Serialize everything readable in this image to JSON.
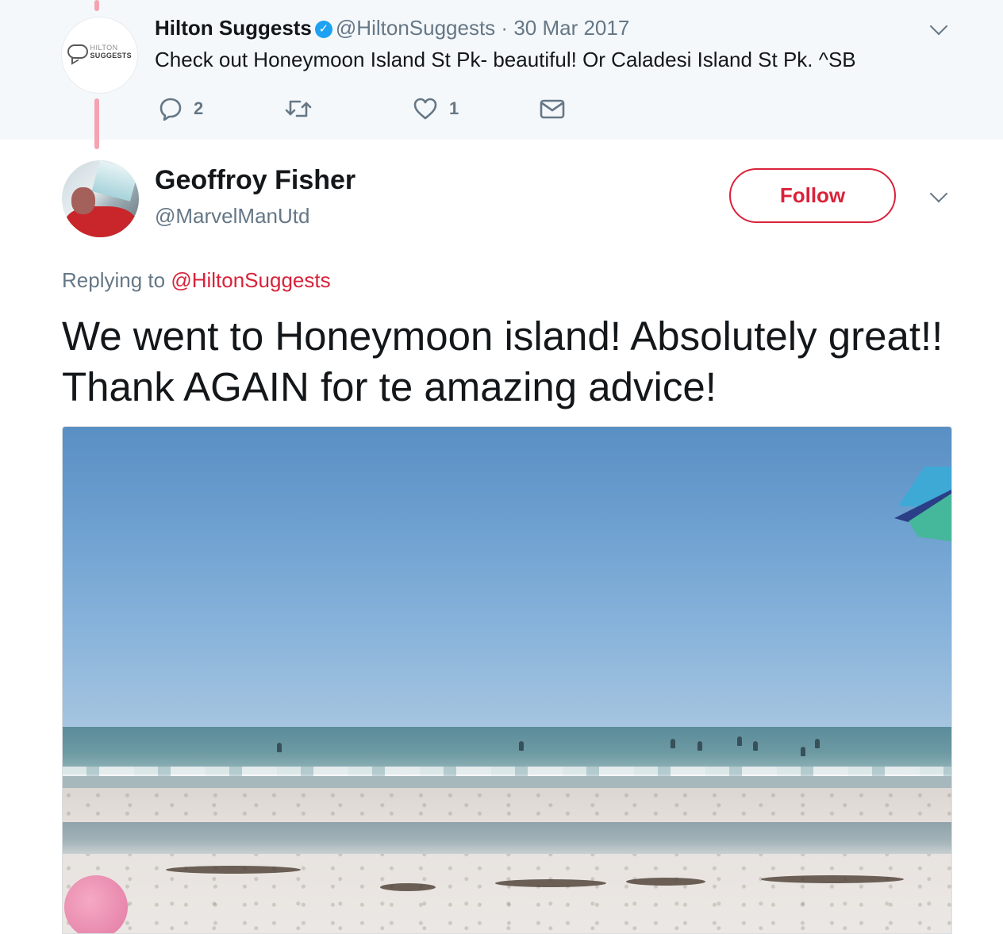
{
  "parent_tweet": {
    "avatar_logo_top": "HILTON",
    "avatar_logo_bottom": "SUGGESTS",
    "name": "Hilton Suggests",
    "verified_icon": "verified-badge",
    "handle": "@HiltonSuggests",
    "separator": "·",
    "date": "30 Mar 2017",
    "text": "Check out Honeymoon Island St Pk- beautiful!  Or Caladesi Island St Pk.  ^SB",
    "actions": {
      "reply_count": "2",
      "retweet_count": "",
      "like_count": "1"
    }
  },
  "main_tweet": {
    "name": "Geoffroy Fisher",
    "handle": "@MarvelManUtd",
    "follow_label": "Follow",
    "replying_prefix": "Replying to",
    "replying_handle": "@HiltonSuggests",
    "text": "We went to Honeymoon island! Absolutely great!! Thank AGAIN for te amazing advice!",
    "photo_subject": "beach"
  },
  "colors": {
    "accent_red": "#d9223a",
    "thread_line": "#f4a3b1",
    "muted_text": "#657786",
    "verified_blue": "#1da1f2",
    "parent_bg": "#f5f8fa"
  }
}
